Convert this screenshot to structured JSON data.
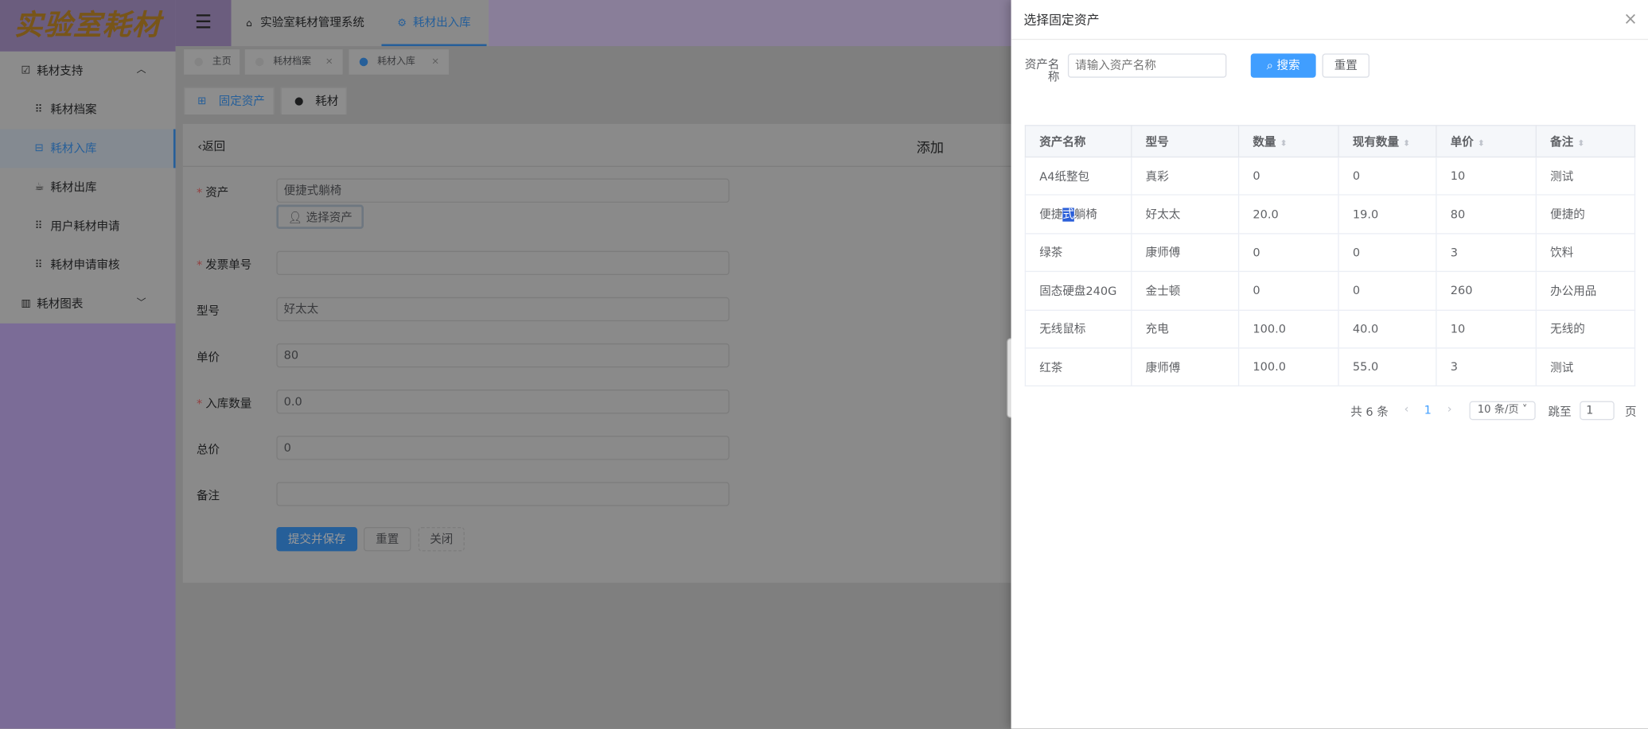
{
  "app": {
    "logo": "实验室耗材",
    "menu_icon": "hamburger-icon"
  },
  "nav_tabs": [
    {
      "label": "实验室耗材管理系统",
      "icon": "home-icon"
    },
    {
      "label": "耗材出入库",
      "icon": "gear-icon",
      "active": true
    }
  ],
  "sidebar": {
    "items": [
      {
        "label": "耗材支持",
        "icon": "chart-check-icon",
        "expanded": true
      },
      {
        "label": "耗材档案",
        "icon": "grid-icon"
      },
      {
        "label": "耗材入库",
        "icon": "basket-icon",
        "active": true
      },
      {
        "label": "耗材出库",
        "icon": "cup-icon"
      },
      {
        "label": "用户耗材申请",
        "icon": "grid-icon"
      },
      {
        "label": "耗材申请审核",
        "icon": "grid-icon"
      },
      {
        "label": "耗材图表",
        "icon": "barcode-icon",
        "expanded": false
      }
    ]
  },
  "tags": [
    {
      "label": "主页"
    },
    {
      "label": "耗材档案"
    },
    {
      "label": "耗材入库",
      "active": true
    }
  ],
  "sub_tabs": [
    {
      "label": "固定资产",
      "icon": "windows-icon",
      "active": true
    },
    {
      "label": "耗材",
      "icon": "apple-icon"
    }
  ],
  "form": {
    "back": "返回",
    "title": "添加",
    "fields": [
      {
        "label": "资产",
        "required": true,
        "value": "便捷式躺椅"
      },
      {
        "label": "发票单号",
        "required": true,
        "value": ""
      },
      {
        "label": "型号",
        "required": false,
        "value": "好太太"
      },
      {
        "label": "单价",
        "required": false,
        "value": "80"
      },
      {
        "label": "入库数量",
        "required": true,
        "value": "0.0"
      },
      {
        "label": "总价",
        "required": false,
        "value": "0"
      },
      {
        "label": "备注",
        "required": false,
        "value": ""
      }
    ],
    "select_asset": "选择资产",
    "submit": "提交并保存",
    "reset": "重置",
    "close": "关闭"
  },
  "drawer": {
    "title": "选择固定资产",
    "search_label": "资产名称",
    "search_placeholder": "请输入资产名称",
    "search_btn": "搜索",
    "reset_btn": "重置",
    "columns": [
      "资产名称",
      "型号",
      "数量",
      "现有数量",
      "单价",
      "备注"
    ],
    "rows": [
      [
        "A4纸整包",
        "真彩",
        "0",
        "0",
        "10",
        "测试"
      ],
      [
        "便捷式躺椅",
        "好太太",
        "20.0",
        "19.0",
        "80",
        "便捷的"
      ],
      [
        "绿茶",
        "康师傅",
        "0",
        "0",
        "3",
        "饮料"
      ],
      [
        "固态硬盘240G",
        "金士顿",
        "0",
        "0",
        "260",
        "办公用品"
      ],
      [
        "无线鼠标",
        "充电",
        "100.0",
        "40.0",
        "10",
        "无线的"
      ],
      [
        "红茶",
        "康师傅",
        "100.0",
        "55.0",
        "3",
        "测试"
      ]
    ],
    "pagination": {
      "total": "共 6 条",
      "current": "1",
      "page_size": "10 条/页",
      "jump_label": "跳至",
      "jump_value": "1",
      "page_suffix": "页"
    }
  },
  "colors": {
    "primary": "#409eff",
    "sidebar": "#7b6c97",
    "logo": "#c98e2a"
  }
}
